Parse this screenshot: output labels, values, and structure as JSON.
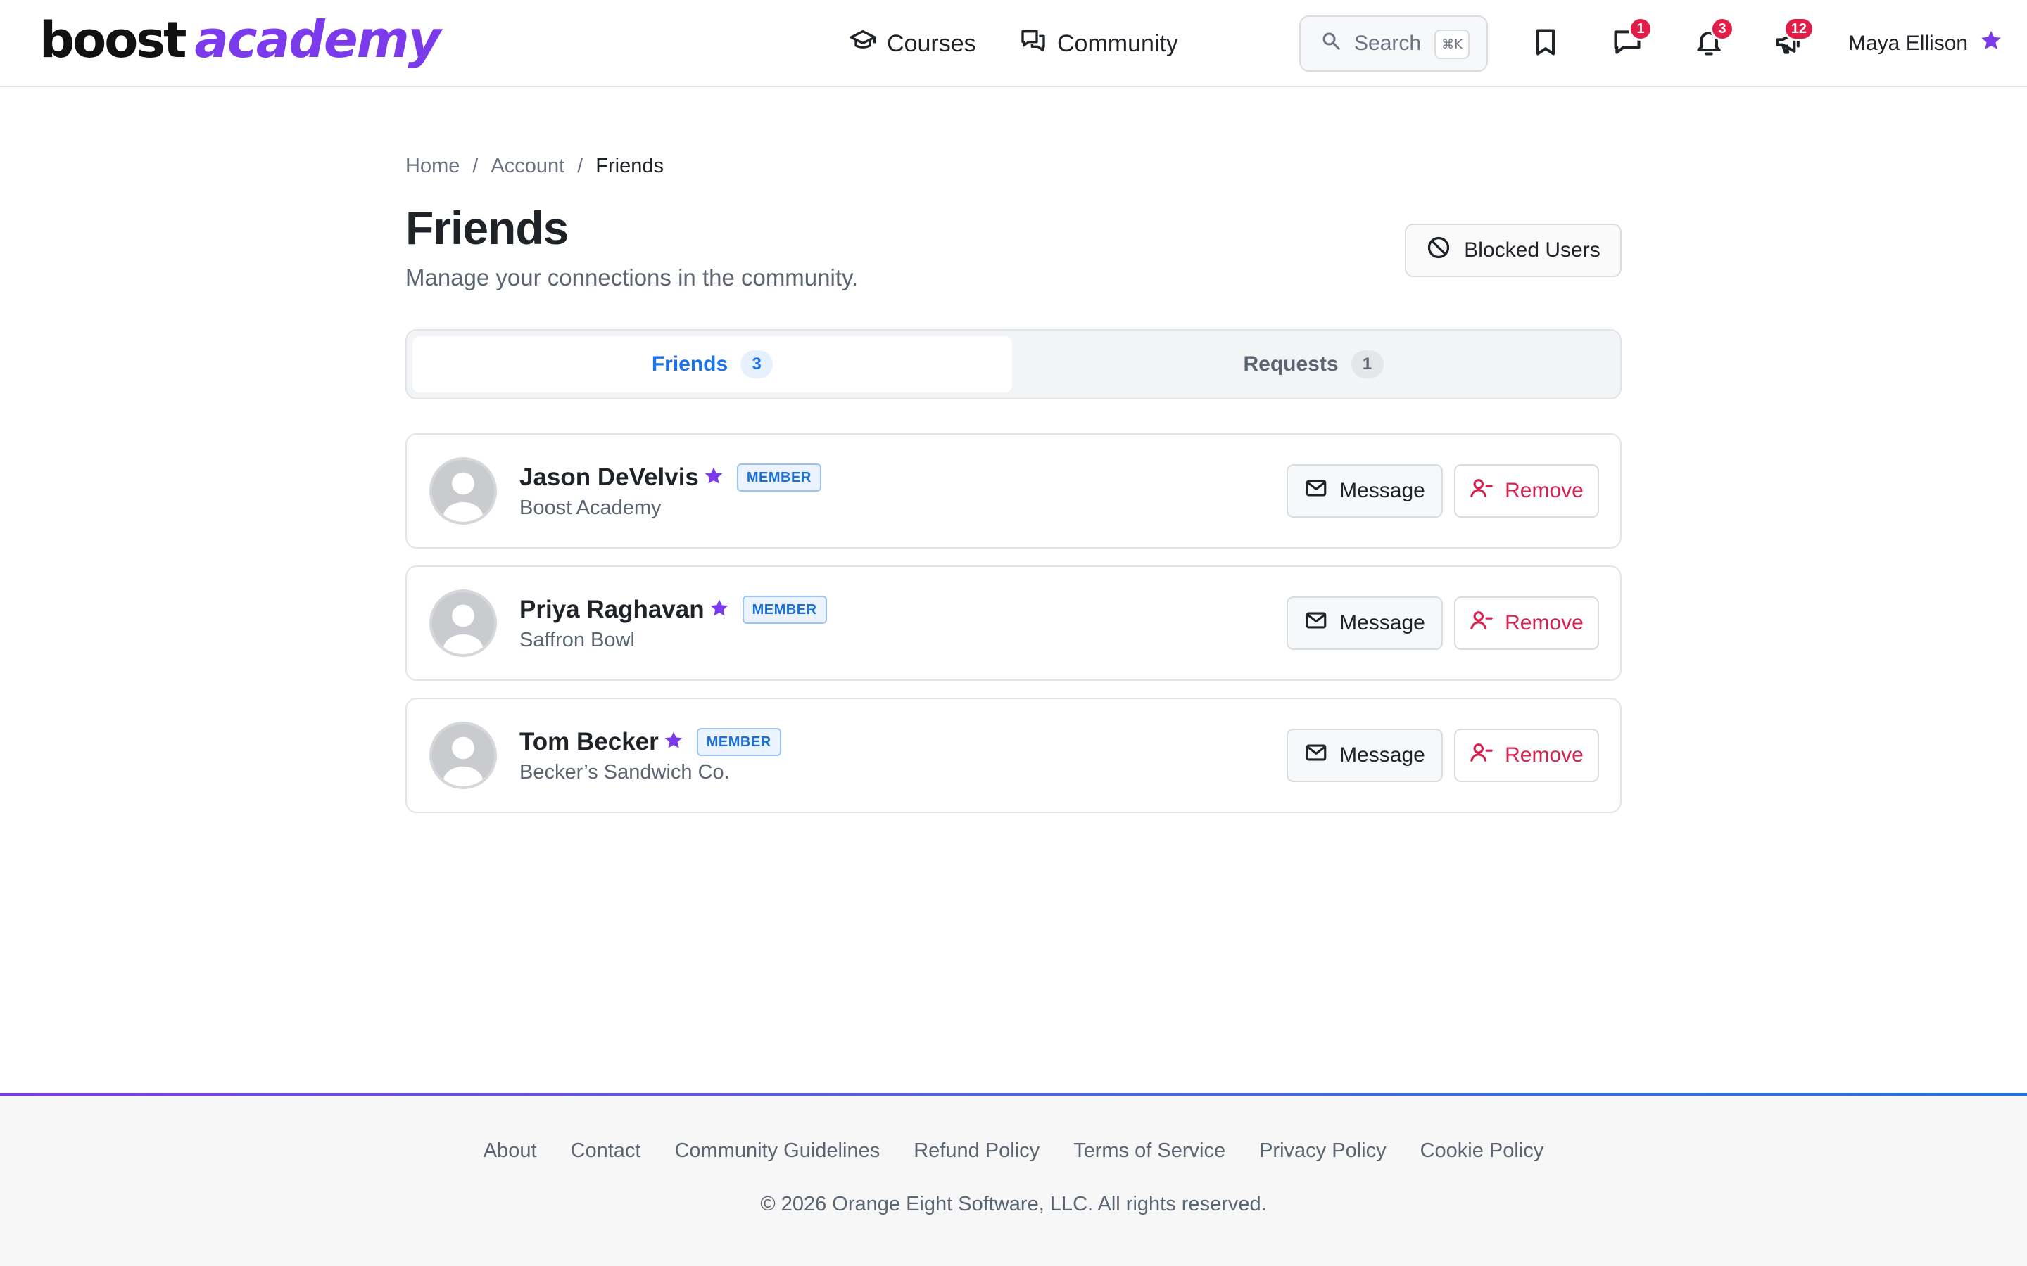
{
  "brand": {
    "logo_part1": "boost",
    "logo_part2": "academy",
    "accent_color": "#7c3aed"
  },
  "header": {
    "nav": [
      {
        "label": "Courses",
        "icon": "graduation-cap-icon"
      },
      {
        "label": "Community",
        "icon": "chat-bubbles-icon"
      }
    ],
    "search": {
      "placeholder": "Search",
      "shortcut": "⌘K"
    },
    "icons": [
      {
        "name": "bookmark-icon",
        "badge": ""
      },
      {
        "name": "messages-icon",
        "badge": "1"
      },
      {
        "name": "bell-icon",
        "badge": "3"
      },
      {
        "name": "megaphone-icon",
        "badge": "12"
      }
    ],
    "badge_color": "#e11d48",
    "user": {
      "name": "Maya Ellison",
      "icon": "star-icon"
    }
  },
  "breadcrumb": {
    "items": [
      "Home",
      "Account",
      "Friends"
    ],
    "separator": "/"
  },
  "page": {
    "title": "Friends",
    "subtitle": "Manage your connections in the community.",
    "blocked_button": "Blocked Users"
  },
  "tabs": [
    {
      "label": "Friends",
      "count": "3",
      "active": true
    },
    {
      "label": "Requests",
      "count": "1",
      "active": false
    }
  ],
  "friends": [
    {
      "name": "Jason DeVelvis",
      "role": "MEMBER",
      "company": "Boost Academy",
      "message_label": "Message",
      "remove_label": "Remove"
    },
    {
      "name": "Priya Raghavan",
      "role": "MEMBER",
      "company": "Saffron Bowl",
      "message_label": "Message",
      "remove_label": "Remove"
    },
    {
      "name": "Tom Becker",
      "role": "MEMBER",
      "company": "Becker’s Sandwich Co.",
      "message_label": "Message",
      "remove_label": "Remove"
    }
  ],
  "footer": {
    "links": [
      "About",
      "Contact",
      "Community Guidelines",
      "Refund Policy",
      "Terms of Service",
      "Privacy Policy",
      "Cookie Policy"
    ],
    "copyright": "© 2026 Orange Eight Software, LLC. All rights reserved."
  }
}
